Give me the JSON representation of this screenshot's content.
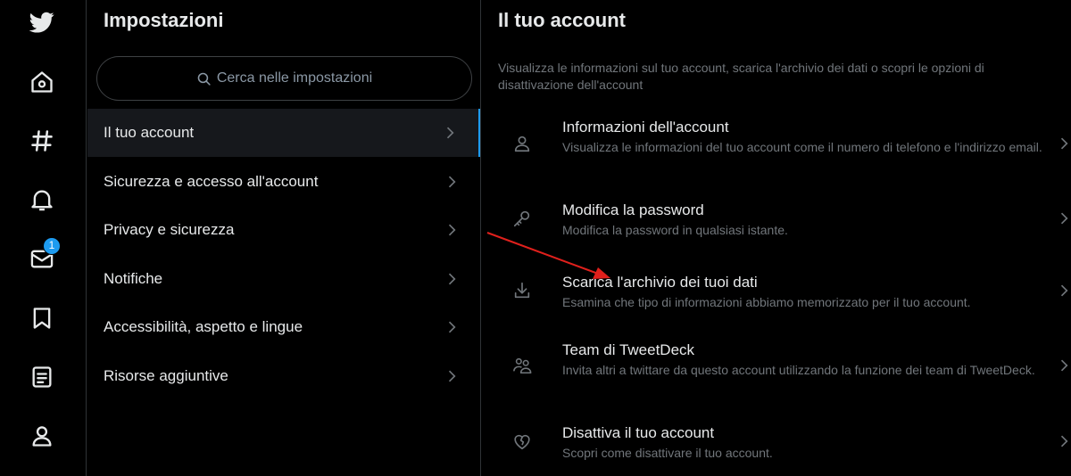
{
  "nav": {
    "icons": [
      "twitter-logo-icon",
      "home-icon",
      "hashtag-icon",
      "bell-icon",
      "envelope-icon",
      "bookmark-icon",
      "list-icon",
      "person-icon"
    ],
    "messages_badge": "1"
  },
  "settings": {
    "title": "Impostazioni",
    "search_placeholder": "Cerca nelle impostazioni",
    "items": [
      {
        "label": "Il tuo account",
        "active": true
      },
      {
        "label": "Sicurezza e accesso all'account"
      },
      {
        "label": "Privacy e sicurezza"
      },
      {
        "label": "Notifiche"
      },
      {
        "label": "Accessibilità, aspetto e lingue"
      },
      {
        "label": "Risorse aggiuntive"
      }
    ]
  },
  "account": {
    "title": "Il tuo account",
    "description": "Visualizza le informazioni sul tuo account, scarica l'archivio dei dati o scopri le opzioni di disattivazione dell'account",
    "items": [
      {
        "icon": "person-icon",
        "title": "Informazioni dell'account",
        "subtitle": "Visualizza le informazioni del tuo account come il numero di telefono e l'indirizzo email."
      },
      {
        "icon": "key-icon",
        "title": "Modifica la password",
        "subtitle": "Modifica la password in qualsiasi istante."
      },
      {
        "icon": "download-icon",
        "title": "Scarica l'archivio dei tuoi dati",
        "subtitle": "Esamina che tipo di informazioni abbiamo memorizzato per il tuo account."
      },
      {
        "icon": "people-icon",
        "title": "Team di TweetDeck",
        "subtitle": "Invita altri a twittare da questo account utilizzando la funzione dei team di TweetDeck."
      },
      {
        "icon": "broken-heart-icon",
        "title": "Disattiva il tuo account",
        "subtitle": "Scopri come disattivare il tuo account."
      }
    ]
  },
  "colors": {
    "accent": "#1d9bf0",
    "annotation_arrow": "#e0201c",
    "background": "#000000"
  }
}
